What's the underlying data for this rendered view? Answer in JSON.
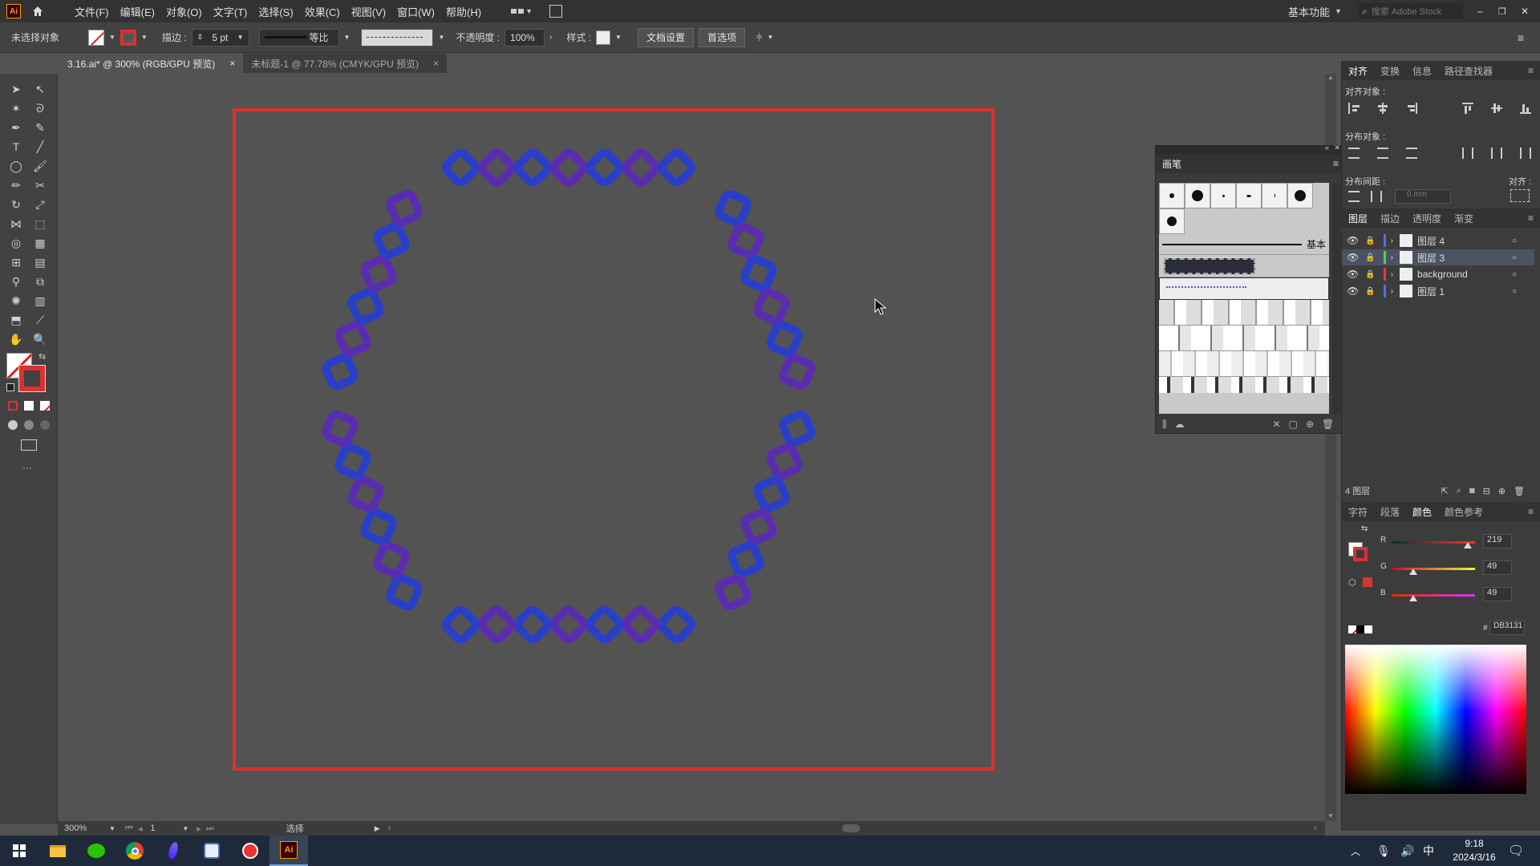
{
  "app": {
    "logo": "Ai",
    "menu": [
      "文件(F)",
      "编辑(E)",
      "对象(O)",
      "文字(T)",
      "选择(S)",
      "效果(C)",
      "视图(V)",
      "窗口(W)",
      "帮助(H)"
    ],
    "workspace": "基本功能",
    "search_placeholder": "搜索 Adobe Stock"
  },
  "control_bar": {
    "selection_label": "未选择对象",
    "stroke_label": "描边 :",
    "stroke_value": "5 pt",
    "profile_label": "等比",
    "opacity_label": "不透明度 :",
    "opacity_value": "100%",
    "style_label": "样式 :",
    "doc_settings_button": "文档设置",
    "preferences_button": "首选项"
  },
  "tabs": [
    {
      "label": "3.16.ai* @ 300% (RGB/GPU 预览)",
      "close": "×"
    },
    {
      "label": "未标题-1 @ 77.78% (CMYK/GPU 预览)",
      "close": "×"
    }
  ],
  "brush_panel": {
    "title": "画笔",
    "basic_label": "基本"
  },
  "align_panel": {
    "tabs": [
      "对齐",
      "变换",
      "信息",
      "路径查找器"
    ],
    "align_objects": "对齐对象 :",
    "distribute_objects": "分布对象 :",
    "distribute_spacing": "分布间距 :",
    "align_to": "对齐 :",
    "spacing_value": "0 mm"
  },
  "layers_panel": {
    "tabs": [
      "图层",
      "描边",
      "透明度",
      "渐变"
    ],
    "layers": [
      {
        "name": "图层 4",
        "color": "#4f6bff"
      },
      {
        "name": "图层 3",
        "color": "#4fd14f"
      },
      {
        "name": "background",
        "color": "#e04040"
      },
      {
        "name": "图层 1",
        "color": "#4f6bff"
      }
    ],
    "count_label": "4 图层"
  },
  "color_panel": {
    "tabs": [
      "字符",
      "段落",
      "颜色",
      "颜色参考"
    ],
    "r_label": "R",
    "r_value": "219",
    "g_label": "G",
    "g_value": "49",
    "b_label": "B",
    "b_value": "49",
    "hex_label": "#",
    "hex_value": "DB3131"
  },
  "status_bar": {
    "zoom": "300%",
    "page": "1",
    "tool": "选择"
  },
  "taskbar": {
    "ime": "中",
    "time": "9:18",
    "date": "2024/3/16"
  },
  "colors": {
    "artboard_border": "#db3131",
    "chain_blue": "#2a3fc8",
    "chain_purple": "#5a2db0"
  }
}
